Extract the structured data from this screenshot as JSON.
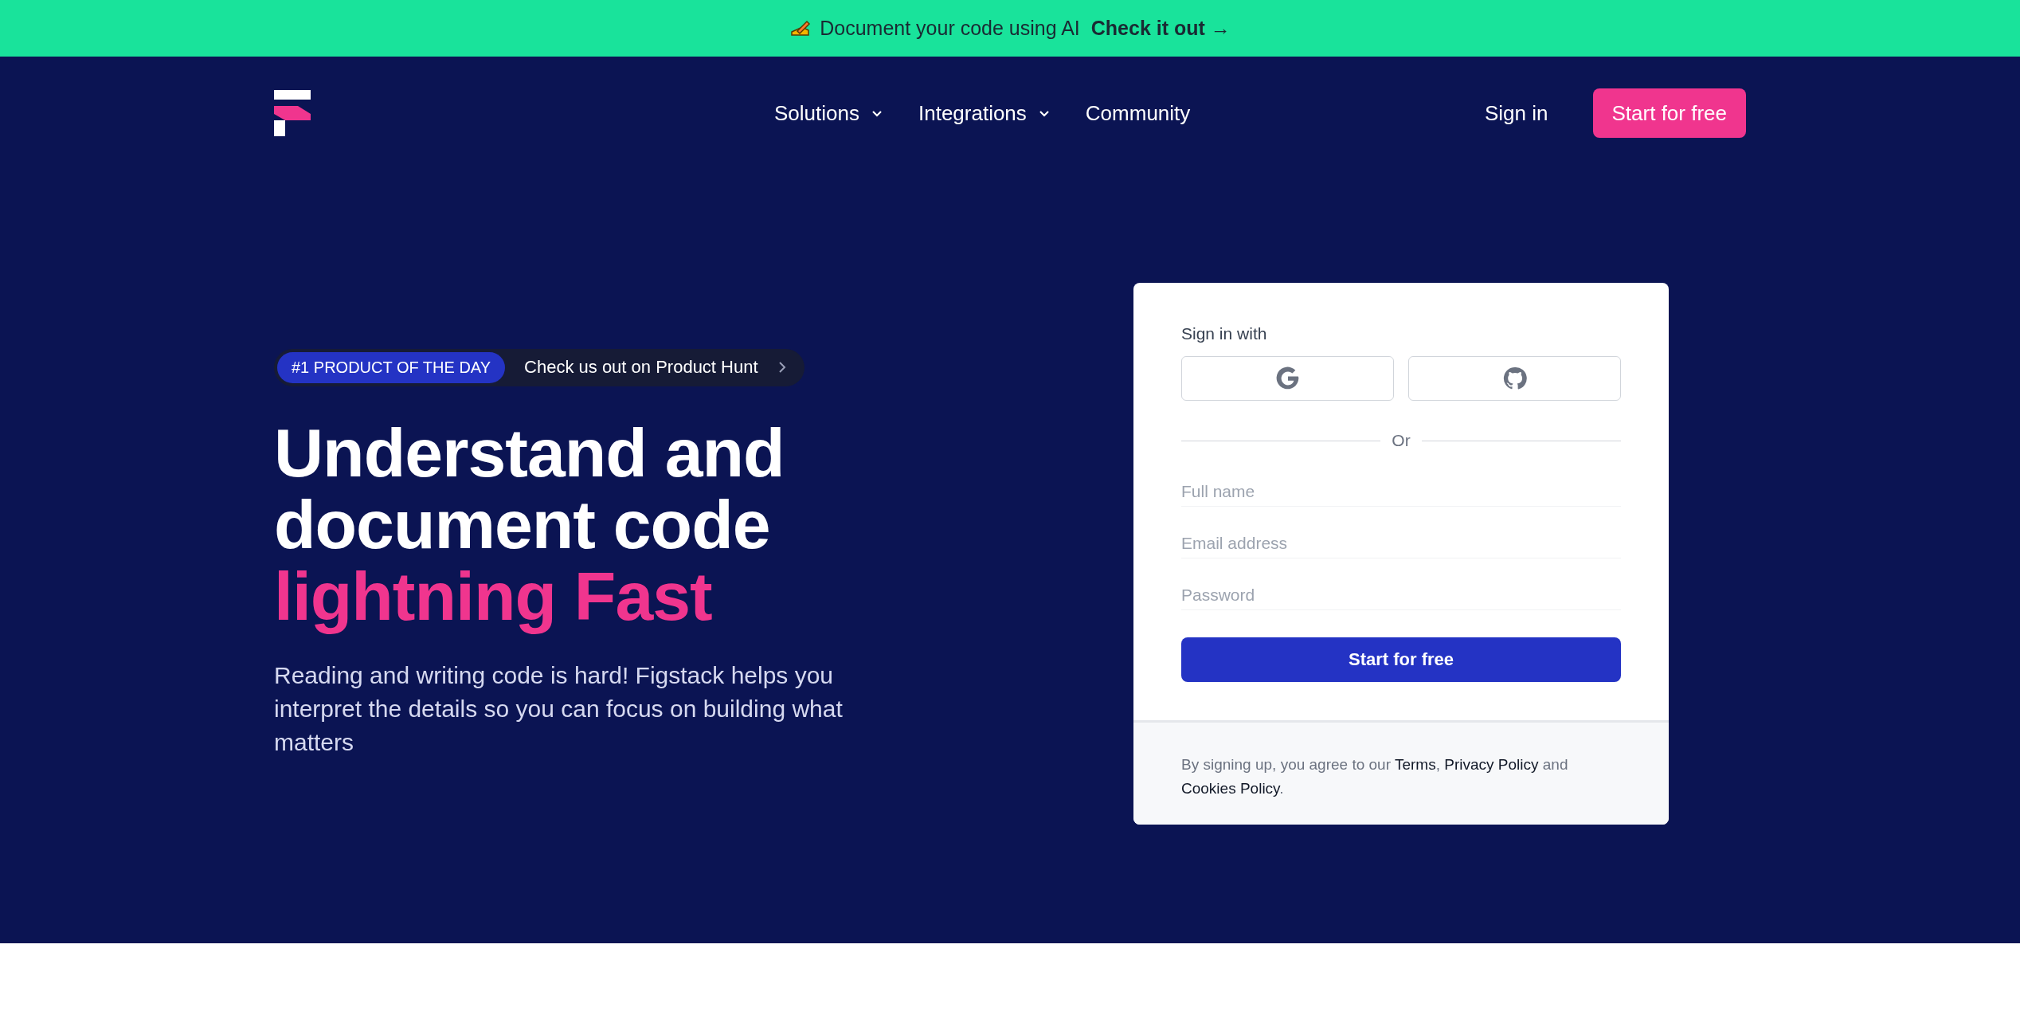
{
  "announcement": {
    "text": "Document your code using AI",
    "link": "Check it out →"
  },
  "nav": {
    "items": [
      {
        "label": "Solutions",
        "has_menu": true
      },
      {
        "label": "Integrations",
        "has_menu": true
      },
      {
        "label": "Community",
        "has_menu": false
      }
    ],
    "sign_in": "Sign in",
    "cta": "Start for free"
  },
  "hero": {
    "badge": {
      "tag": "#1 PRODUCT OF THE DAY",
      "text": "Check us out on Product Hunt"
    },
    "heading": [
      {
        "text": "Understand and",
        "highlight": false
      },
      {
        "text": "document code",
        "highlight": false
      },
      {
        "text": "lightning Fast",
        "highlight": true
      }
    ],
    "description": "Reading and writing code is hard! Figstack helps you interpret the details so you can focus on building what matters"
  },
  "signup": {
    "sign_in_with": "Sign in with",
    "providers": [
      {
        "kind": "google"
      },
      {
        "kind": "github"
      }
    ],
    "divider": "Or",
    "fields": [
      {
        "placeholder": "Full name"
      },
      {
        "placeholder": "Email address"
      },
      {
        "placeholder": "Password"
      }
    ],
    "submit": "Start for free",
    "legal": [
      {
        "kind": "text",
        "text": "By signing up, you agree to our "
      },
      {
        "kind": "link",
        "text": "Terms"
      },
      {
        "kind": "text",
        "text": ", "
      },
      {
        "kind": "link",
        "text": "Privacy Policy"
      },
      {
        "kind": "text",
        "text": " and "
      },
      {
        "kind": "link",
        "text": "Cookies Policy"
      },
      {
        "kind": "text",
        "text": "."
      }
    ]
  }
}
